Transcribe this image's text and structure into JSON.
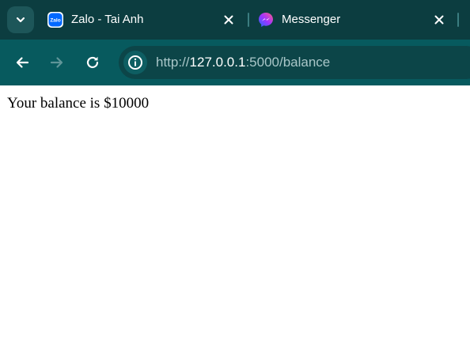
{
  "tabs": [
    {
      "title": "Zalo - Tai Anh",
      "favicon": "zalo-icon",
      "favicon_text": "Zalo",
      "active": false
    },
    {
      "title": "Messenger",
      "favicon": "messenger-icon",
      "active": false
    }
  ],
  "toolbar": {
    "back_icon": "arrow-left-icon",
    "forward_icon": "arrow-right-icon",
    "reload_icon": "reload-icon",
    "site_info_icon": "info-icon",
    "url": {
      "scheme": "http://",
      "host": "127.0.0.1",
      "rest": ":5000/balance"
    }
  },
  "page": {
    "text": "Your balance is $10000"
  },
  "colors": {
    "tabstrip": "#0c3d40",
    "toolbar": "#075a5e",
    "omnibox": "#0c4548",
    "zalo_blue": "#0068ff",
    "page_background": "#ffffff"
  }
}
